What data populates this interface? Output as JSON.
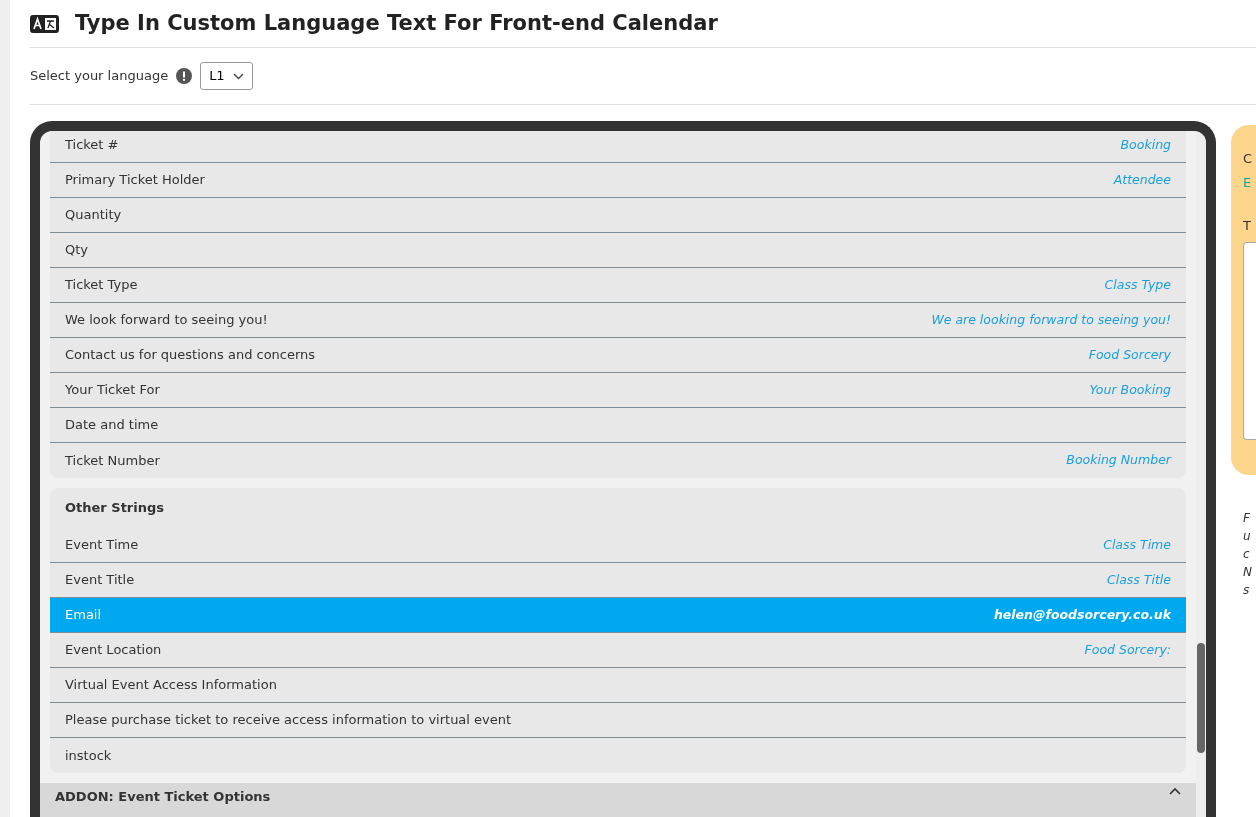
{
  "title": "Type In Custom Language Text For Front-end Calendar",
  "language": {
    "label": "Select your language",
    "value": "L1"
  },
  "groups": [
    {
      "rows": [
        {
          "label": "Ticket #",
          "value": "Booking",
          "selected": false
        },
        {
          "label": "Primary Ticket Holder",
          "value": "Attendee",
          "selected": false
        },
        {
          "label": "Quantity",
          "selected": false
        },
        {
          "label": "Qty",
          "selected": false
        },
        {
          "label": "Ticket Type",
          "value": "Class Type",
          "selected": false
        },
        {
          "label": "We look forward to seeing you!",
          "value": "We are looking forward to seeing you!",
          "selected": false
        },
        {
          "label": "Contact us for questions and concerns",
          "value": "Food Sorcery",
          "selected": false
        },
        {
          "label": "Your Ticket For",
          "value": "Your Booking",
          "selected": false
        },
        {
          "label": "Date and time",
          "selected": false
        },
        {
          "label": "Ticket Number",
          "value": "Booking Number",
          "selected": false
        }
      ]
    },
    {
      "title": "Other Strings",
      "rows": [
        {
          "label": "Event Time",
          "value": "Class Time",
          "selected": false
        },
        {
          "label": "Event Title",
          "value": "Class Title",
          "selected": false
        },
        {
          "label": "Email",
          "value": "helen@foodsorcery.co.uk",
          "selected": true
        },
        {
          "label": "Event Location",
          "value": "Food Sorcery:",
          "selected": false
        },
        {
          "label": "Virtual Event Access Information",
          "selected": false
        },
        {
          "label": "Please purchase ticket to receive access information to virtual event",
          "selected": false
        },
        {
          "label": "instock",
          "selected": false
        }
      ]
    }
  ],
  "addon": {
    "title": "ADDON: Event Ticket Options",
    "expanded": true
  },
  "side_panel": {
    "heading": "C",
    "link": "E",
    "field_label": "T",
    "notes": [
      "F",
      "u",
      "c",
      "N",
      "s"
    ]
  }
}
